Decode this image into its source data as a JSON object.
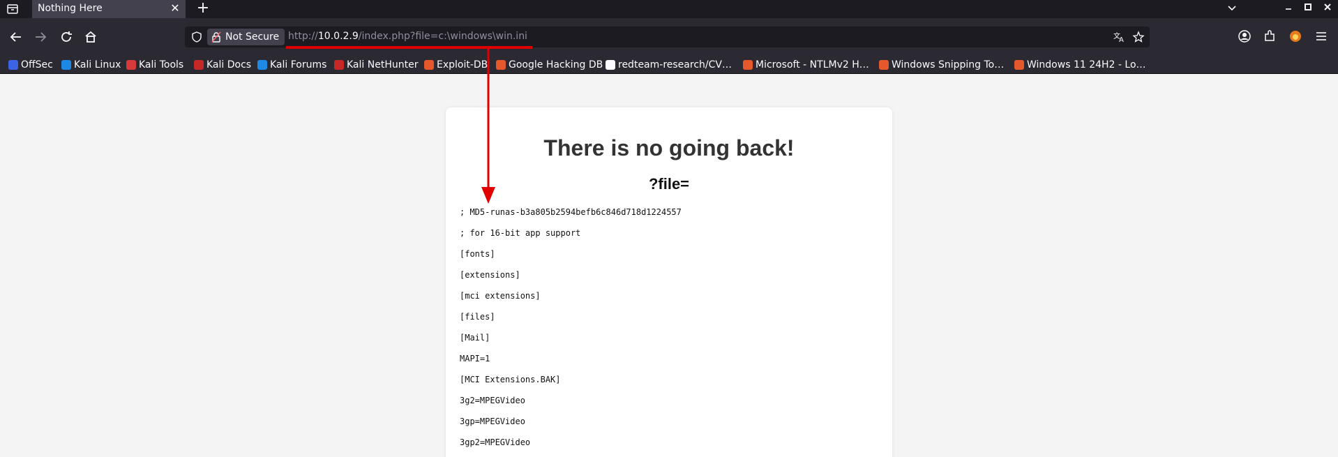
{
  "tab": {
    "title": "Nothing Here"
  },
  "navbar": {
    "security_label": "Not Secure",
    "url_scheme": "http://",
    "url_host": "10.0.2.9",
    "url_path": "/index.php?file=c:\\windows\\win.ini"
  },
  "bookmarks": [
    {
      "label": "OffSec",
      "color": "#3c63e6"
    },
    {
      "label": "Kali Linux",
      "color": "#1e88e5"
    },
    {
      "label": "Kali Tools",
      "color": "#d63a3a"
    },
    {
      "label": "Kali Docs",
      "color": "#c62828"
    },
    {
      "label": "Kali Forums",
      "color": "#1e88e5"
    },
    {
      "label": "Kali NetHunter",
      "color": "#c62828"
    },
    {
      "label": "Exploit-DB",
      "color": "#e5582b"
    },
    {
      "label": "Google Hacking DB",
      "color": "#e5582b"
    },
    {
      "label": "redteam-research/CV…",
      "color": "#fbfbfe"
    },
    {
      "label": "Microsoft - NTLMv2 H…",
      "color": "#e5582b"
    },
    {
      "label": "Windows Snipping To…",
      "color": "#e5582b"
    },
    {
      "label": "Windows 11 24H2 - Lo…",
      "color": "#e5582b"
    }
  ],
  "page": {
    "heading": "There is no going back!",
    "subheading": "?file=",
    "file_lines": [
      "; MD5-runas-b3a805b2594befb6c846d718d1224557",
      "; for 16-bit app support",
      "[fonts]",
      "[extensions]",
      "[mci extensions]",
      "[files]",
      "[Mail]",
      "MAPI=1",
      "[MCI Extensions.BAK]",
      "3g2=MPEGVideo",
      "3gp=MPEGVideo",
      "3gp2=MPEGVideo"
    ]
  },
  "colors": {
    "annotation": "#e00000",
    "toolbar": "#2b2a33",
    "tabstrip": "#1c1b22"
  }
}
